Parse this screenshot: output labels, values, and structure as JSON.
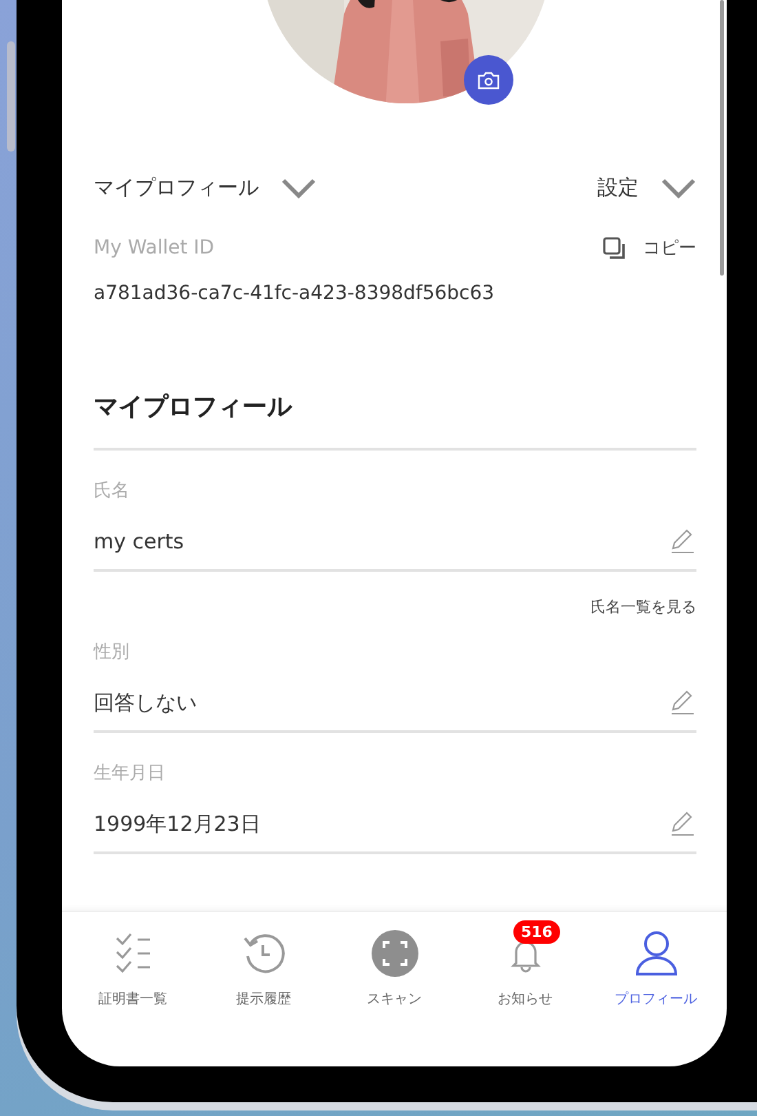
{
  "header": {
    "profile_menu": "マイプロフィール",
    "settings_menu": "設定"
  },
  "wallet": {
    "label": "My Wallet ID",
    "copy": "コピー",
    "id": "a781ad36-ca7c-41fc-a423-8398df56bc63"
  },
  "section_title": "マイプロフィール",
  "fields": [
    {
      "label": "氏名",
      "value": "my certs",
      "link": "氏名一覧を見る"
    },
    {
      "label": "性別",
      "value": "回答しない"
    },
    {
      "label": "生年月日",
      "value": "1999年12月23日"
    }
  ],
  "nav": [
    {
      "kind": "list",
      "label": "証明書一覧",
      "selected": false
    },
    {
      "kind": "history",
      "label": "提示履歴",
      "selected": false
    },
    {
      "kind": "scan",
      "label": "スキャン",
      "selected": false
    },
    {
      "kind": "bell",
      "label": "お知らせ",
      "selected": false,
      "badge": "516"
    },
    {
      "kind": "person",
      "label": "プロフィール",
      "selected": true
    }
  ]
}
